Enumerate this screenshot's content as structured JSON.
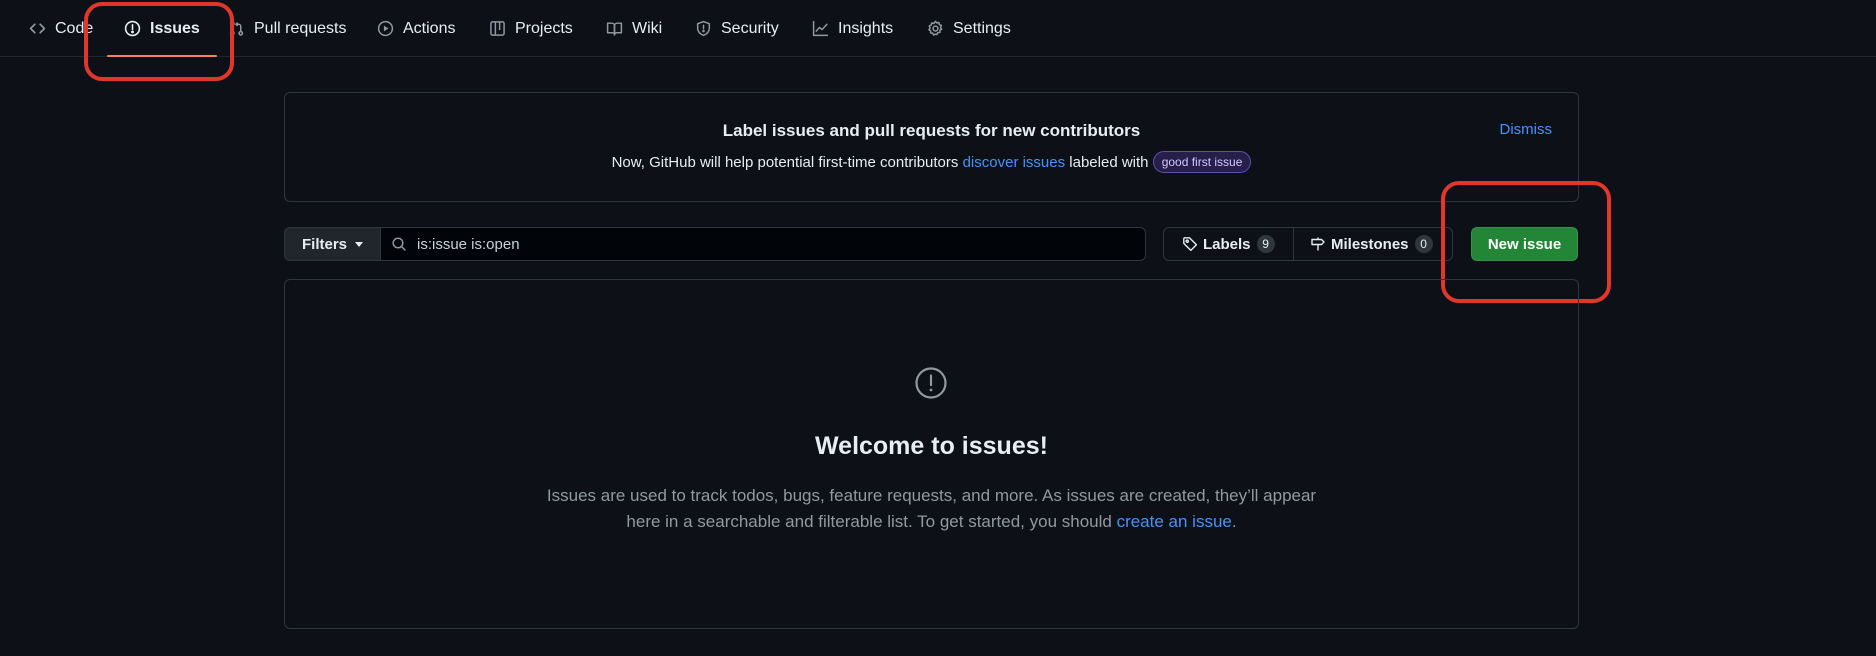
{
  "nav": {
    "tabs": [
      {
        "label": "Code",
        "icon": "code-icon"
      },
      {
        "label": "Issues",
        "icon": "issue-opened-icon",
        "active": true
      },
      {
        "label": "Pull requests",
        "icon": "git-pull-request-icon"
      },
      {
        "label": "Actions",
        "icon": "play-icon"
      },
      {
        "label": "Projects",
        "icon": "table-icon"
      },
      {
        "label": "Wiki",
        "icon": "book-icon"
      },
      {
        "label": "Security",
        "icon": "shield-icon"
      },
      {
        "label": "Insights",
        "icon": "graph-icon"
      },
      {
        "label": "Settings",
        "icon": "gear-icon"
      }
    ]
  },
  "banner": {
    "title": "Label issues and pull requests for new contributors",
    "text_before": "Now, GitHub will help potential first-time contributors ",
    "link": "discover issues",
    "text_after": " labeled with ",
    "label": "good first issue",
    "dismiss": "Dismiss"
  },
  "toolbar": {
    "filters": "Filters",
    "search_value": "is:issue is:open",
    "labels": "Labels",
    "labels_count": "9",
    "milestones": "Milestones",
    "milestones_count": "0",
    "new_issue": "New issue"
  },
  "blankslate": {
    "title": "Welcome to issues!",
    "text": "Issues are used to track todos, bugs, feature requests, and more. As issues are created, they’ll appear here in a searchable and filterable list. To get started, you should ",
    "link": "create an issue",
    "text_end": "."
  },
  "colors": {
    "background": "#0d1117",
    "border": "#30363d",
    "accent_underline": "#f78166",
    "link": "#4493f8",
    "primary_button": "#238636",
    "annotation": "#e0362c"
  }
}
